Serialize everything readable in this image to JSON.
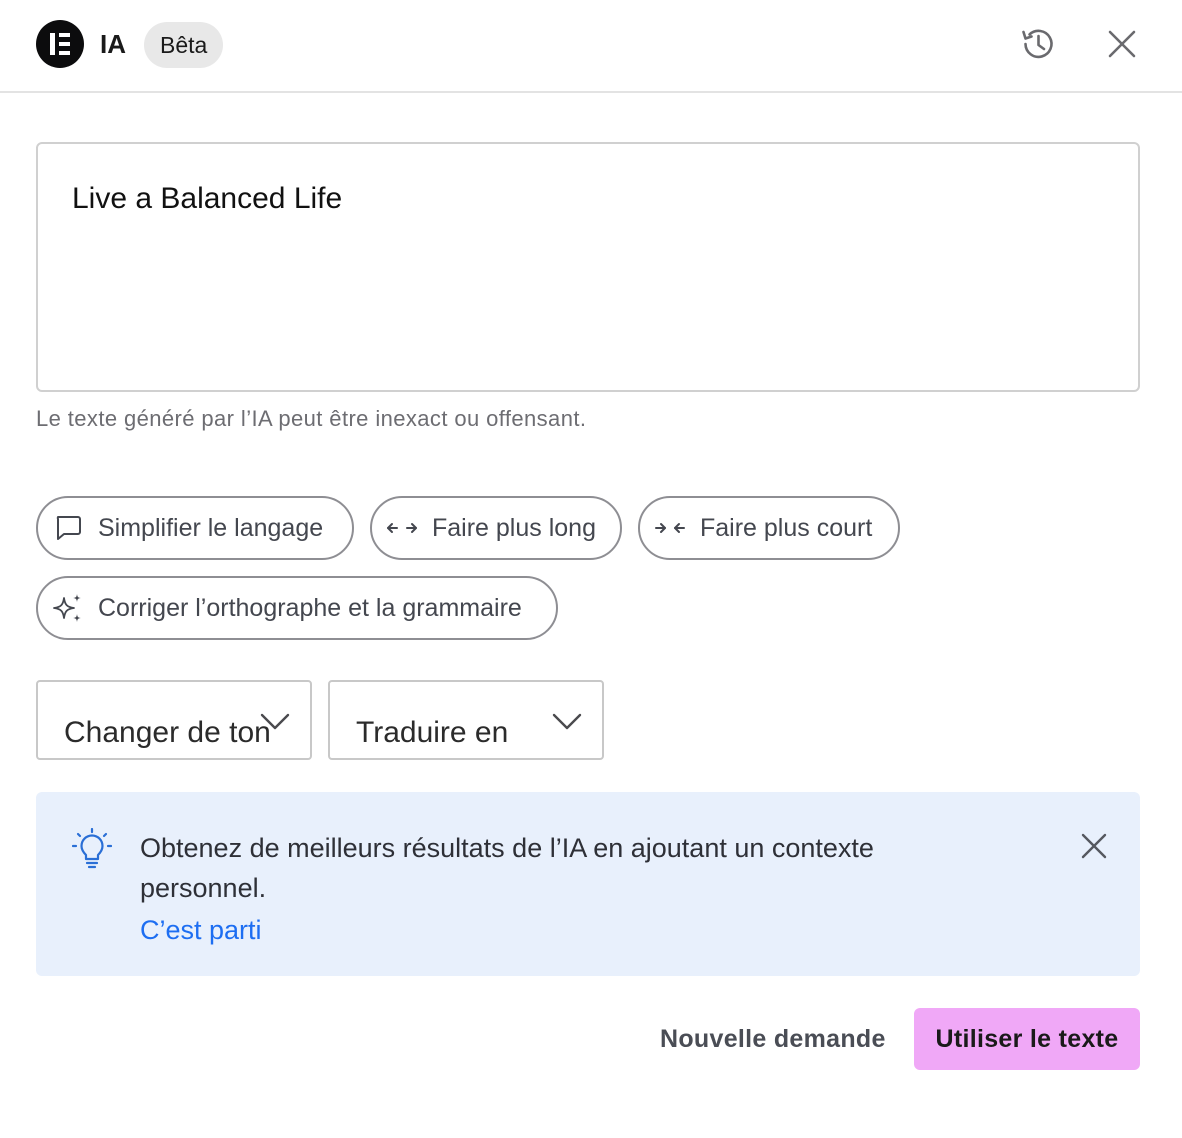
{
  "header": {
    "logo_icon": "elementor-logo-icon",
    "title": "IA",
    "badge": "Bêta",
    "history_icon": "history-icon",
    "close_icon": "close-icon"
  },
  "result": {
    "text": "Live a Balanced Life"
  },
  "disclaimer": "Le texte généré par l’IA peut être inexact ou offensant.",
  "actions": [
    {
      "label": "Simplifier le langage",
      "icon": "speech-bubble-icon"
    },
    {
      "label": "Faire plus long",
      "icon": "expand-arrows-icon"
    },
    {
      "label": "Faire plus court",
      "icon": "shrink-arrows-icon"
    },
    {
      "label": "Corriger l’orthographe et la grammaire",
      "icon": "sparkles-icon"
    }
  ],
  "selects": {
    "tone": {
      "value": "Changer de ton",
      "icon": "chevron-down-icon"
    },
    "translate": {
      "value": "Traduire en",
      "icon": "chevron-down-icon"
    }
  },
  "banner": {
    "icon": "lightbulb-icon",
    "text": "Obtenez de meilleurs résultats de l’IA en ajoutant un contexte personnel.",
    "link": "C’est parti",
    "close_icon": "close-icon"
  },
  "footer": {
    "new_request": "Nouvelle demande",
    "use_text": "Utiliser le texte"
  },
  "colors": {
    "accent_button": "#f0a8f7",
    "link": "#1d6ef2",
    "banner_bg": "#e8f0fc",
    "lightbulb": "#2a6fd6"
  }
}
